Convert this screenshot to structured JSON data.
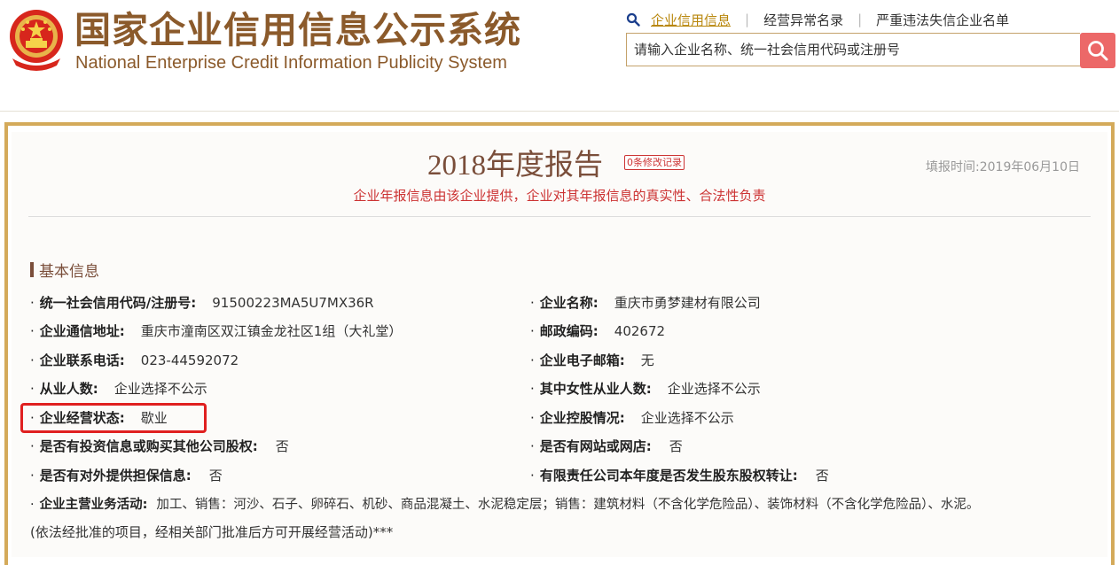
{
  "header": {
    "site_title_cn": "国家企业信用信息公示系统",
    "site_title_en": "National Enterprise Credit Information Publicity System",
    "search_tabs": [
      {
        "label": "企业信用信息",
        "active": true
      },
      {
        "label": "经营异常名录",
        "active": false
      },
      {
        "label": "严重违法失信企业名单",
        "active": false
      }
    ],
    "search_placeholder": "请输入企业名称、统一社会信用代码或注册号"
  },
  "report": {
    "title": "2018年度报告",
    "modification_badge": "0条修改记录",
    "fill_time": "填报时间:2019年06月10日",
    "disclaimer": "企业年报信息由该企业提供，企业对其年报信息的真实性、合法性负责"
  },
  "basic_info": {
    "section_title": "基本信息",
    "left": [
      {
        "label": "统一社会信用代码/注册号:",
        "value": "91500223MA5U7MX36R"
      },
      {
        "label": "企业通信地址:",
        "value": "重庆市潼南区双江镇金龙社区1组（大礼堂）"
      },
      {
        "label": "企业联系电话:",
        "value": "023-44592072"
      },
      {
        "label": "从业人数:",
        "value": "企业选择不公示"
      },
      {
        "label": "企业经营状态:",
        "value": "歇业"
      },
      {
        "label": "是否有投资信息或购买其他公司股权:",
        "value": "否"
      },
      {
        "label": "是否有对外提供担保信息:",
        "value": "否"
      }
    ],
    "right": [
      {
        "label": "企业名称:",
        "value": "重庆市勇梦建材有限公司"
      },
      {
        "label": "邮政编码:",
        "value": "402672"
      },
      {
        "label": "企业电子邮箱:",
        "value": "无"
      },
      {
        "label": "其中女性从业人数:",
        "value": "企业选择不公示"
      },
      {
        "label": "企业控股情况:",
        "value": "企业选择不公示"
      },
      {
        "label": "是否有网站或网店:",
        "value": "否"
      },
      {
        "label": "有限责任公司本年度是否发生股东股权转让:",
        "value": "否"
      }
    ],
    "business_scope": {
      "label": "企业主营业务活动:",
      "value_line1": "加工、销售：河沙、石子、卵碎石、机砂、商品混凝土、水泥稳定层；销售：建筑材料（不含化学危险品）、装饰材料（不含化学危险品）、水泥。",
      "value_line2": "(依法经批准的项目，经相关部门批准后方可开展经营活动)***"
    }
  },
  "colors": {
    "brand_brown": "#8b5a2b",
    "frame_gold": "#d4aa5a",
    "accent_red": "#cc3333",
    "search_button": "#ec6868",
    "highlight_box": "#e02020"
  }
}
